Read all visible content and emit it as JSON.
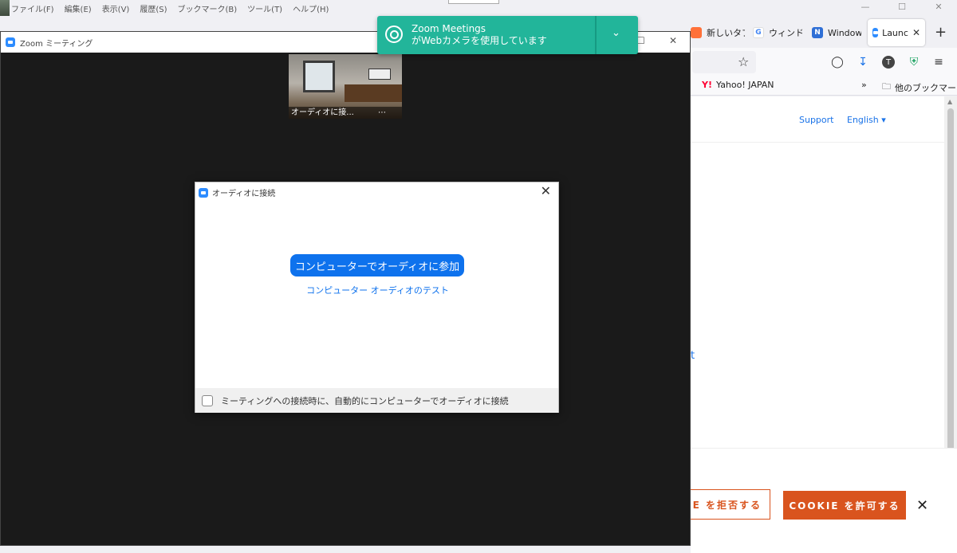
{
  "menubar": {
    "items": [
      "ファイル(F)",
      "編集(E)",
      "表示(V)",
      "履歴(S)",
      "ブックマーク(B)",
      "ツール(T)",
      "ヘルプ(H)"
    ]
  },
  "browser": {
    "tabs": [
      {
        "label": "新しいタブ",
        "icon": "firefox-icon",
        "color": "#ff7139"
      },
      {
        "label": "ウィンドウ",
        "icon": "google-icon",
        "color": "#4285f4"
      },
      {
        "label": "Window",
        "icon": "notion-n-icon",
        "color": "#2f6fd6"
      }
    ],
    "active_tab": {
      "label": "Launc",
      "icon": "zoom-icon"
    },
    "bookmarks": {
      "yahoo": "Yahoo! JAPAN",
      "other": "他のブックマーク"
    }
  },
  "webpage": {
    "support": "Support",
    "language": "English ▾",
    "partial_link": "t",
    "cookie": {
      "deny": "COOKIE を拒否する",
      "allow": "COOKIE を許可する"
    }
  },
  "zoom": {
    "window_title": "Zoom ミーティング",
    "video_label": "オーディオに接...",
    "dialog": {
      "title": "オーディオに接続",
      "join_button": "コンピューターでオーディオに参加",
      "test_link": "コンピューター オーディオのテスト",
      "auto_connect_label": "ミーティングへの接続時に、自動的にコンピューターでオーディオに接続",
      "auto_connect_checked": false
    }
  },
  "notification": {
    "title": "Zoom Meetings",
    "message": "がWebカメラを使用しています",
    "color": "#22b59a"
  }
}
